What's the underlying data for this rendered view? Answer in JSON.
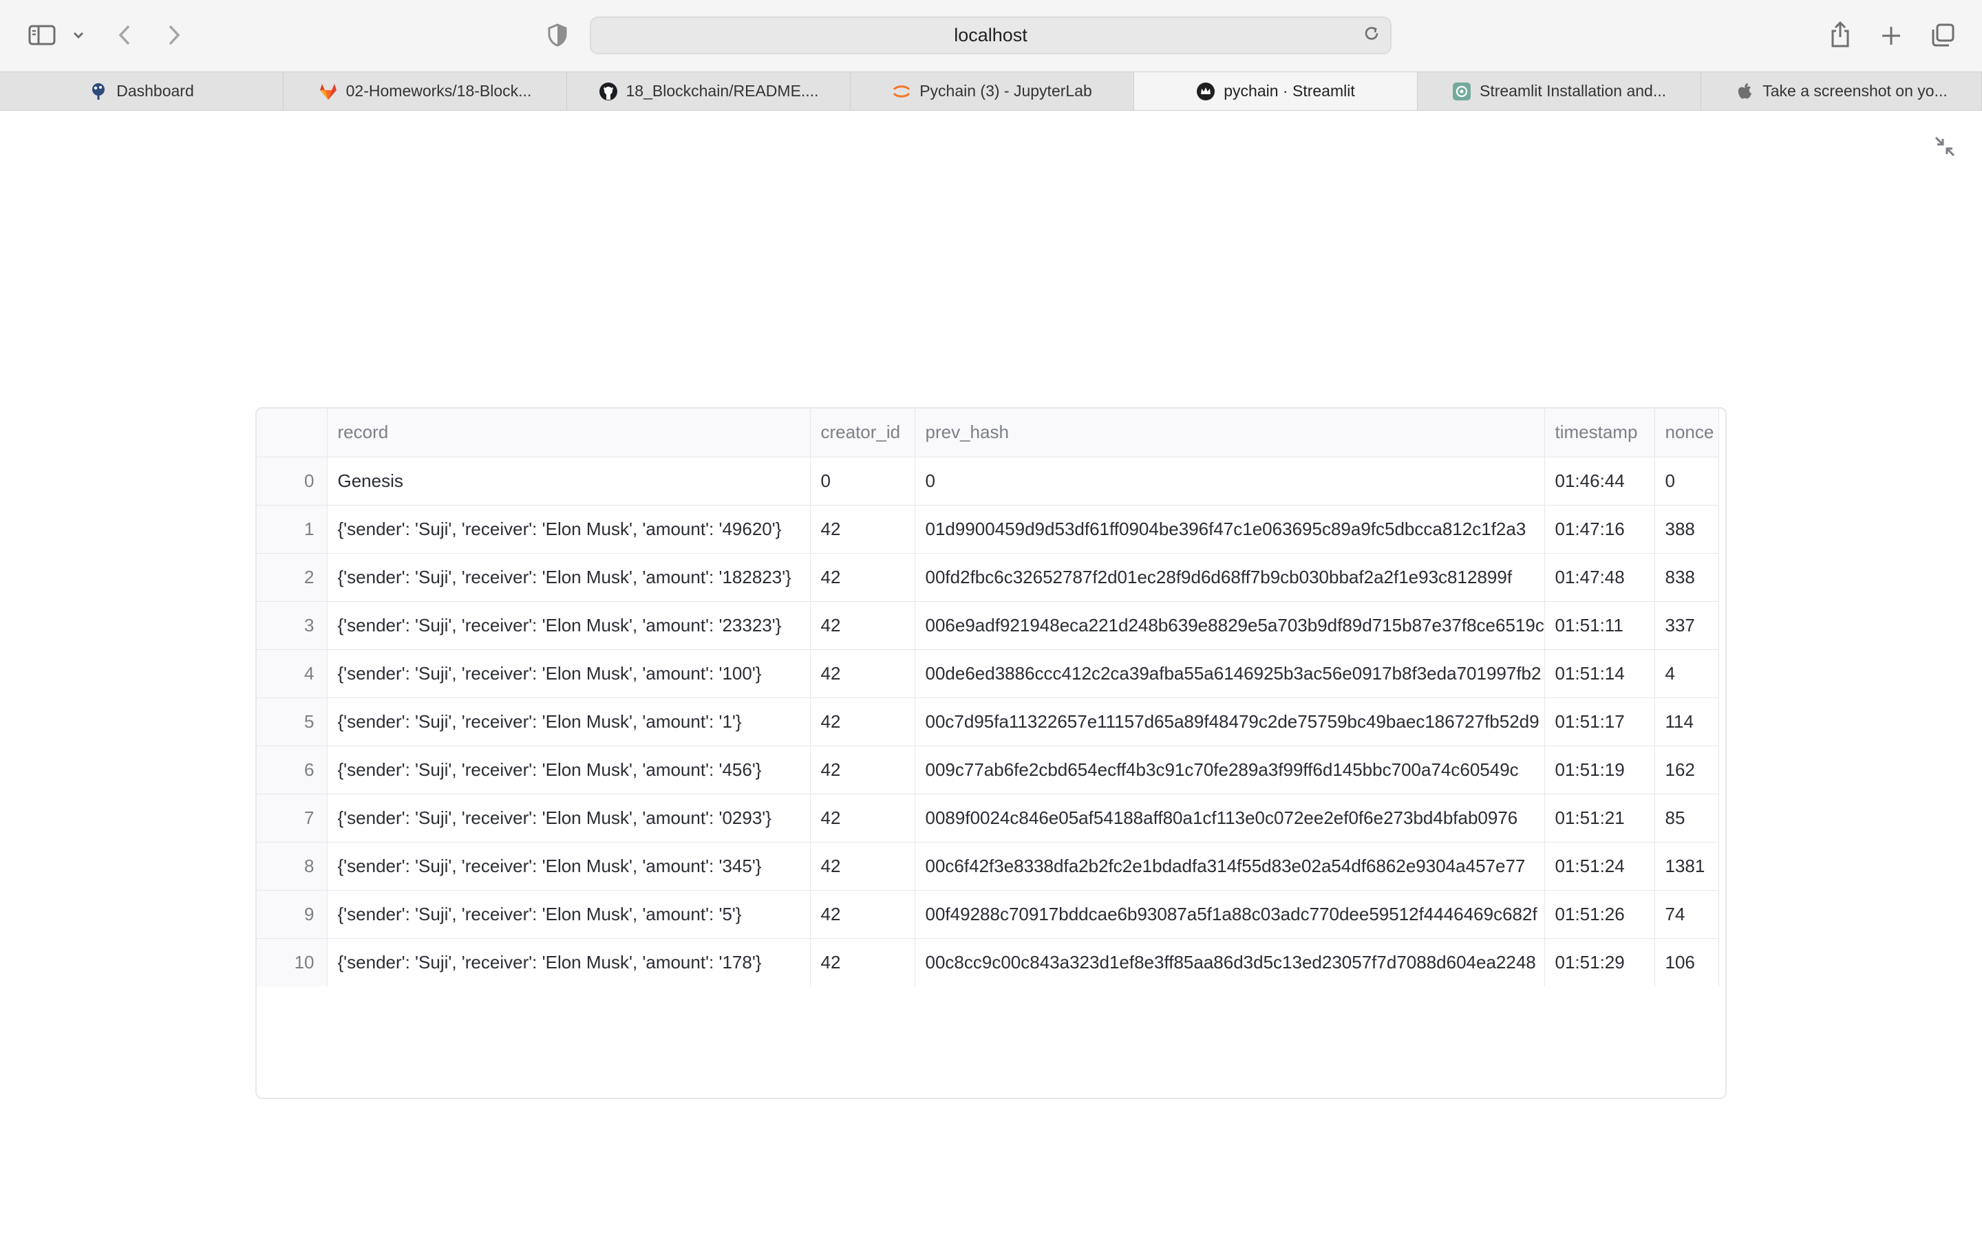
{
  "browser": {
    "url": "localhost",
    "tabs": [
      {
        "label": "Dashboard",
        "icon": "tree-logo-icon",
        "active": false
      },
      {
        "label": "02-Homeworks/18-Block...",
        "icon": "gitlab-icon",
        "active": false
      },
      {
        "label": "18_Blockchain/README....",
        "icon": "github-icon",
        "active": false
      },
      {
        "label": "Pychain (3) - JupyterLab",
        "icon": "jupyter-icon",
        "active": false
      },
      {
        "label": "pychain · Streamlit",
        "icon": "streamlit-crown-icon",
        "active": true
      },
      {
        "label": "Streamlit Installation and...",
        "icon": "chatgpt-icon",
        "active": false
      },
      {
        "label": "Take a screenshot on yo...",
        "icon": "apple-icon",
        "active": false
      }
    ]
  },
  "table": {
    "columns": [
      "",
      "record",
      "creator_id",
      "prev_hash",
      "timestamp",
      "nonce"
    ],
    "rows": [
      [
        "0",
        "Genesis",
        "0",
        "0",
        "01:46:44",
        "0"
      ],
      [
        "1",
        "{'sender': 'Suji', 'receiver': 'Elon Musk', 'amount': '49620'}",
        "42",
        "01d9900459d9d53df61ff0904be396f47c1e063695c89a9fc5dbcca812c1f2a3",
        "01:47:16",
        "388"
      ],
      [
        "2",
        "{'sender': 'Suji', 'receiver': 'Elon Musk', 'amount': '182823'}",
        "42",
        "00fd2fbc6c32652787f2d01ec28f9d6d68ff7b9cb030bbaf2a2f1e93c812899f",
        "01:47:48",
        "838"
      ],
      [
        "3",
        "{'sender': 'Suji', 'receiver': 'Elon Musk', 'amount': '23323'}",
        "42",
        "006e9adf921948eca221d248b639e8829e5a703b9df89d715b87e37f8ce6519c",
        "01:51:11",
        "337"
      ],
      [
        "4",
        "{'sender': 'Suji', 'receiver': 'Elon Musk', 'amount': '100'}",
        "42",
        "00de6ed3886ccc412c2ca39afba55a6146925b3ac56e0917b8f3eda701997fb2",
        "01:51:14",
        "4"
      ],
      [
        "5",
        "{'sender': 'Suji', 'receiver': 'Elon Musk', 'amount': '1'}",
        "42",
        "00c7d95fa11322657e11157d65a89f48479c2de75759bc49baec186727fb52d9",
        "01:51:17",
        "114"
      ],
      [
        "6",
        "{'sender': 'Suji', 'receiver': 'Elon Musk', 'amount': '456'}",
        "42",
        "009c77ab6fe2cbd654ecff4b3c91c70fe289a3f99ff6d145bbc700a74c60549c",
        "01:51:19",
        "162"
      ],
      [
        "7",
        "{'sender': 'Suji', 'receiver': 'Elon Musk', 'amount': '0293'}",
        "42",
        "0089f0024c846e05af54188aff80a1cf113e0c072ee2ef0f6e273bd4bfab0976",
        "01:51:21",
        "85"
      ],
      [
        "8",
        "{'sender': 'Suji', 'receiver': 'Elon Musk', 'amount': '345'}",
        "42",
        "00c6f42f3e8338dfa2b2fc2e1bdadfa314f55d83e02a54df6862e9304a457e77",
        "01:51:24",
        "1381"
      ],
      [
        "9",
        "{'sender': 'Suji', 'receiver': 'Elon Musk', 'amount': '5'}",
        "42",
        "00f49288c70917bddcae6b93087a5f1a88c03adc770dee59512f4446469c682f",
        "01:51:26",
        "74"
      ],
      [
        "10",
        "{'sender': 'Suji', 'receiver': 'Elon Musk', 'amount': '178'}",
        "42",
        "00c8cc9c00c843a323d1ef8e3ff85aa86d3d5c13ed23057f7d7088d604ea2248",
        "01:51:29",
        "106"
      ]
    ]
  }
}
